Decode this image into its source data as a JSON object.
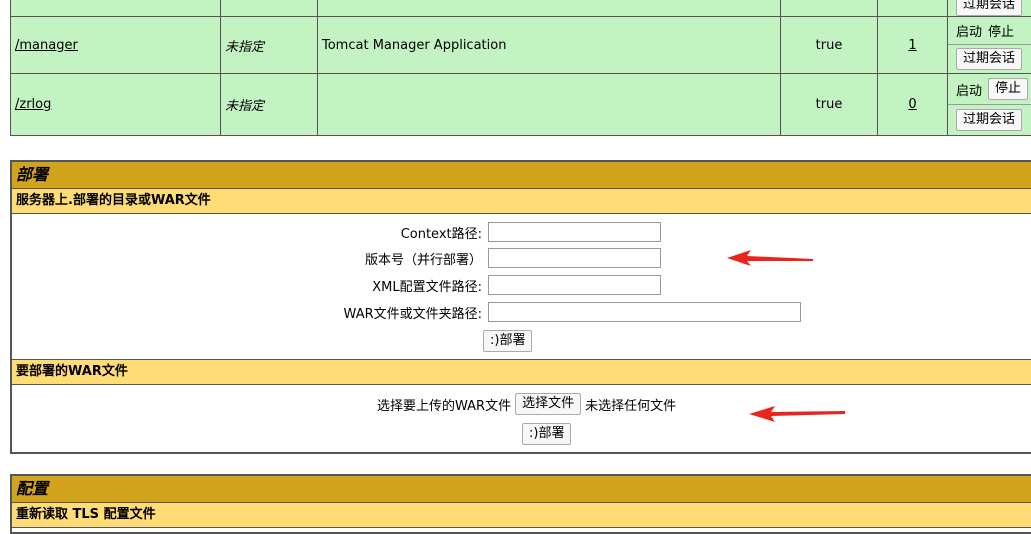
{
  "apps": [
    {
      "path": "",
      "version": "",
      "display_name": "",
      "running": "",
      "sessions": "",
      "cmd": {
        "expire": "过期会话"
      }
    },
    {
      "path": "/manager",
      "version": "未指定",
      "display_name": "Tomcat Manager Application",
      "running": "true",
      "sessions": "1",
      "cmd": {
        "start": "启动",
        "stop": "停止",
        "expire": "过期会话"
      }
    },
    {
      "path": "/zrlog",
      "version": "未指定",
      "display_name": "",
      "running": "true",
      "sessions": "0",
      "cmd": {
        "start": "启动",
        "stop": "停止",
        "expire": "过期会话"
      }
    }
  ],
  "deploy": {
    "title": "部署",
    "server_section": "服务器上.部署的目录或WAR文件",
    "context_label": "Context路径:",
    "version_label": "版本号（并行部署）",
    "xml_label": "XML配置文件路径:",
    "war_label": "WAR文件或文件夹路径:",
    "deploy_button": ":)部署",
    "upload_section": "要部署的WAR文件",
    "upload_label": "选择要上传的WAR文件",
    "choose_button": "选择文件",
    "no_file": "未选择任何文件",
    "upload_deploy_button": ":)部署"
  },
  "config": {
    "title": "配置",
    "tls_section": "重新读取 TLS 配置文件"
  },
  "colors": {
    "row_green": "#c3f2c3",
    "title_gold": "#d2a31c",
    "sub_yellow": "#ffdc75",
    "arrow_red": "#e8241c"
  }
}
